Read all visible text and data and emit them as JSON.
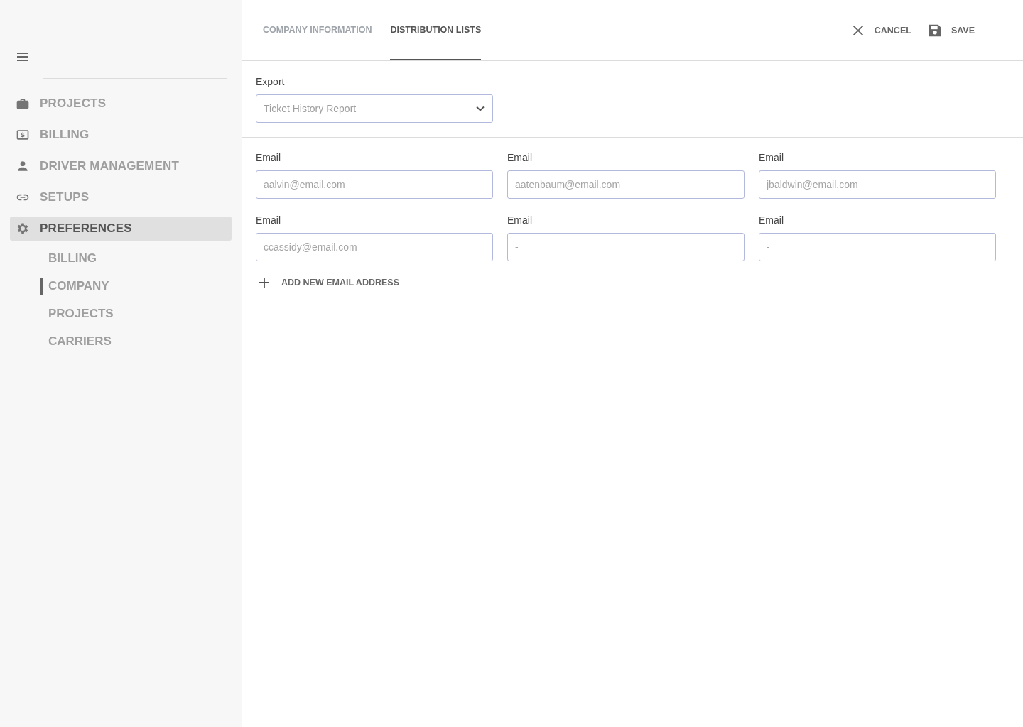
{
  "sidebar": {
    "items": [
      {
        "label": "PROJECTS",
        "selected": false
      },
      {
        "label": "BILLING",
        "selected": false
      },
      {
        "label": "DRIVER MANAGEMENT",
        "selected": false
      },
      {
        "label": "SETUPS",
        "selected": false
      },
      {
        "label": "PREFERENCES",
        "selected": true,
        "children": [
          {
            "label": "BILLING",
            "selected": false
          },
          {
            "label": "COMPANY",
            "selected": true
          },
          {
            "label": "PROJECTS",
            "selected": false
          },
          {
            "label": "CARRIERS",
            "selected": false
          }
        ]
      }
    ]
  },
  "tabs": [
    {
      "label": "COMPANY INFORMATION",
      "selected": false
    },
    {
      "label": "DISTRIBUTION LISTS",
      "selected": true
    }
  ],
  "actions": [
    {
      "label": "CANCEL",
      "kind": "cancel"
    },
    {
      "label": "SAVE",
      "kind": "save"
    }
  ],
  "export": {
    "label": "Export",
    "placeholder": "Ticket History Report"
  },
  "emails": [
    {
      "label": "Email",
      "placeholder": "aalvin@email.com"
    },
    {
      "label": "Email",
      "placeholder": "aatenbaum@email.com"
    },
    {
      "label": "Email",
      "placeholder": "jbaldwin@email.com"
    },
    {
      "label": "Email",
      "placeholder": "ccassidy@email.com"
    },
    {
      "label": "Email",
      "placeholder": "-"
    },
    {
      "label": "Email",
      "placeholder": "-"
    }
  ],
  "add_button": {
    "label": "ADD NEW EMAIL ADDRESS"
  }
}
